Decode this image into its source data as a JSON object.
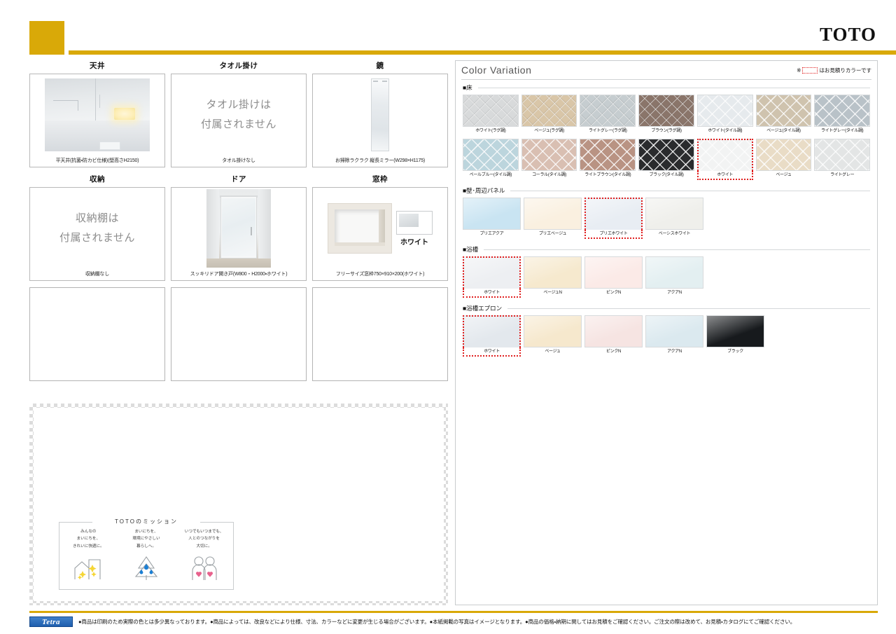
{
  "header": {
    "brand": "TOTO",
    "accent_color": "#d9a908"
  },
  "left_panel": {
    "rows": [
      {
        "cards": [
          {
            "title": "天井",
            "kind": "photo-ceiling",
            "caption": "平天井(抗菌・防カビ仕様)(壁高さH2150)",
            "notice": ""
          },
          {
            "title": "タオル掛け",
            "kind": "notice",
            "caption": "タオル掛けなし",
            "notice_line1": "タオル掛けは",
            "notice_line2": "付属されません"
          },
          {
            "title": "鏡",
            "kind": "photo-mirror",
            "caption": "お掃除ラクラク 縦長ミラー(W298×H1175)",
            "notice": ""
          }
        ]
      },
      {
        "cards": [
          {
            "title": "収納",
            "kind": "notice",
            "caption": "収納棚なし",
            "notice_line1": "収納棚は",
            "notice_line2": "付属されません"
          },
          {
            "title": "ドア",
            "kind": "photo-door",
            "caption": "スッキリドア開き戸(W800・H2000・ホワイト)",
            "notice": ""
          },
          {
            "title": "窓枠",
            "kind": "photo-window",
            "caption": "フリーサイズ窓枠750×910×200(ホワイト)",
            "chip_label": "ホワイト",
            "notice": ""
          }
        ]
      },
      {
        "cards": [
          {
            "title": "",
            "kind": "blank",
            "caption": "",
            "notice": ""
          },
          {
            "title": "",
            "kind": "blank",
            "caption": "",
            "notice": ""
          },
          {
            "title": "",
            "kind": "blank",
            "caption": "",
            "notice": ""
          }
        ]
      }
    ]
  },
  "mission": {
    "title": "TOTOのミッション",
    "columns": [
      {
        "line1": "みんなの",
        "line2": "まいにちを、",
        "line3": "きれいに快適に。",
        "art": "houses-sparkle"
      },
      {
        "line1": "まいにちを、",
        "line2": "環境にやさしい",
        "line3": "暮らしへ。",
        "art": "tree-droplets"
      },
      {
        "line1": "いつでもいつまでも、",
        "line2": "人とのつながりを",
        "line3": "大切に。",
        "art": "people-hearts"
      }
    ]
  },
  "color_variation": {
    "title": "Color Variation",
    "note_prefix": "※",
    "note_suffix": "はお見積りカラーです",
    "quote_color": "#e02020",
    "sections": [
      {
        "label": "■床",
        "rows": [
          [
            {
              "name": "ホワイト(ラグ調)",
              "color": "#d8dadb",
              "texture": "rug",
              "selected": false
            },
            {
              "name": "ベージュ(ラグ調)",
              "color": "#d9c6a8",
              "texture": "rug",
              "selected": false
            },
            {
              "name": "ライトグレー(ラグ調)",
              "color": "#c6cdd0",
              "texture": "rug",
              "selected": false
            },
            {
              "name": "ブラウン(ラグ調)",
              "color": "#8a756a",
              "texture": "rug",
              "selected": false
            },
            {
              "name": "ホワイト(タイル調)",
              "color": "#e6eaed",
              "texture": "tile",
              "selected": false
            },
            {
              "name": "ベージュ(タイル調)",
              "color": "#cfc3ae",
              "texture": "tile",
              "selected": false
            },
            {
              "name": "ライトグレー(タイル調)",
              "color": "#b9c2c8",
              "texture": "tile",
              "selected": false
            }
          ],
          [
            {
              "name": "ペールブルー(タイル調)",
              "color": "#bcd5dd",
              "texture": "tile",
              "selected": false
            },
            {
              "name": "コーラル(タイル調)",
              "color": "#d9bfb2",
              "texture": "tile",
              "selected": false
            },
            {
              "name": "ライトブラウン(タイル調)",
              "color": "#b99383",
              "texture": "tile",
              "selected": false
            },
            {
              "name": "ブラック(タイル調)",
              "color": "#2a2b2d",
              "texture": "tile",
              "selected": false
            },
            {
              "name": "ホワイト",
              "color": "#f2f3f3",
              "texture": "tile",
              "selected": true
            },
            {
              "name": "ベージュ",
              "color": "#e9dcc6",
              "texture": "tile",
              "selected": false
            },
            {
              "name": "ライトグレー",
              "color": "#e3e5e5",
              "texture": "tile",
              "selected": false
            }
          ]
        ]
      },
      {
        "label": "■壁･周辺パネル",
        "rows": [
          [
            {
              "name": "プリエアクア",
              "color": "#c9e4f2",
              "texture": "plain",
              "selected": false
            },
            {
              "name": "プリエベージュ",
              "color": "#faf0e0",
              "texture": "plain",
              "selected": false
            },
            {
              "name": "プリエホワイト",
              "color": "#e8edf3",
              "texture": "plain",
              "selected": true
            },
            {
              "name": "ベーシスホワイト",
              "color": "#efefeb",
              "texture": "plain",
              "selected": false
            }
          ]
        ]
      },
      {
        "label": "■浴槽",
        "rows": [
          [
            {
              "name": "ホワイト",
              "color": "#edeff2",
              "texture": "plain",
              "selected": true
            },
            {
              "name": "ベージュN",
              "color": "#f6e9ce",
              "texture": "plain",
              "selected": false
            },
            {
              "name": "ピンクN",
              "color": "#fbeae7",
              "texture": "plain",
              "selected": false
            },
            {
              "name": "アクアN",
              "color": "#e3eff1",
              "texture": "plain",
              "selected": false
            }
          ]
        ]
      },
      {
        "label": "■浴槽エプロン",
        "rows": [
          [
            {
              "name": "ホワイト",
              "color": "#e3e8ed",
              "texture": "plain",
              "selected": true
            },
            {
              "name": "ベージュ",
              "color": "#f6e8cd",
              "texture": "plain",
              "selected": false
            },
            {
              "name": "ピンクN",
              "color": "#f6e4e2",
              "texture": "plain",
              "selected": false
            },
            {
              "name": "アクアN",
              "color": "#dbe9ef",
              "texture": "plain",
              "selected": false
            },
            {
              "name": "ブラック",
              "color": "#171a1d",
              "texture": "plain",
              "selected": false
            }
          ]
        ]
      }
    ]
  },
  "footer": {
    "badge": "Tetra",
    "disclaimer": "●商品は印刷のため実際の色とは多少異なっております。●商品によっては、改良などにより仕様、寸法、カラーなどに変更が生じる場合がございます。●本紙掲載の写真はイメージとなります。●商品の価格・納期に関してはお見積をご確認ください。ご注文の際は改めて、お見積・カタログにてご確認ください。"
  }
}
